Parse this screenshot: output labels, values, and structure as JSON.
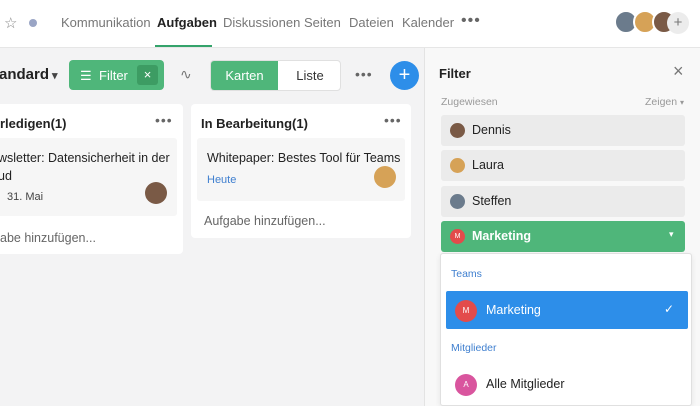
{
  "nav": {
    "tabs": [
      "Kommunikation",
      "Aufgaben",
      "Diskussionen",
      "Seiten",
      "Dateien",
      "Kalender"
    ],
    "active_tab": "Aufgaben",
    "more_label": "•••",
    "add_label": "+"
  },
  "toolbar": {
    "view_name": "tandard",
    "filter_label": "Filter",
    "filter_clear": "×",
    "view_toggle": [
      "Karten",
      "Liste"
    ],
    "more_label": "•••",
    "add_label": "+"
  },
  "board": {
    "columns": [
      {
        "title": "rledigen(1)",
        "more": "•••",
        "cards": [
          {
            "text_line1": "wsletter: Datensicherheit in der",
            "text_line2": "ud",
            "meta": "31. Mai"
          }
        ],
        "add_task": "abe hinzufügen..."
      },
      {
        "title": "In Bearbeitung(1)",
        "more": "•••",
        "cards": [
          {
            "text_line1": "Whitepaper: Bestes Tool für Teams",
            "meta": "Heute"
          }
        ],
        "add_task": "Aufgabe hinzufügen..."
      }
    ]
  },
  "filter_panel": {
    "title": "Filter",
    "close_icon": "×",
    "assigned_label": "Zugewiesen",
    "show_label": "Zeigen",
    "people": [
      "Dennis",
      "Laura",
      "Steffen"
    ],
    "selected": {
      "label": "Marketing",
      "badge": "M"
    },
    "dropdown": {
      "teams_label": "Teams",
      "team_item": {
        "label": "Marketing",
        "badge": "M"
      },
      "members_label": "Mitglieder",
      "member_item": {
        "label": "Alle Mitglieder",
        "badge": "A"
      }
    }
  },
  "colors": {
    "accent_green": "#4fb67a",
    "accent_blue": "#2d8ee9",
    "badge_red": "#e34b4b",
    "badge_pink": "#d9559e",
    "due_blue": "#3f7fcf"
  }
}
